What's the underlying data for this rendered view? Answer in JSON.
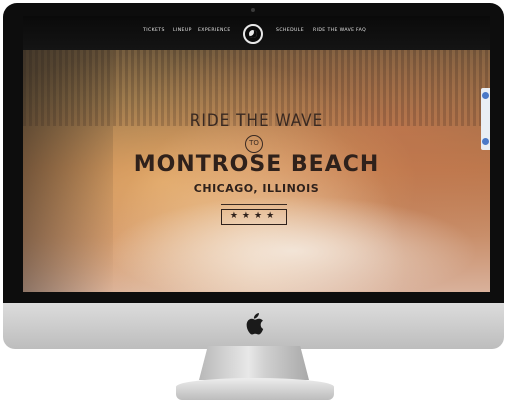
{
  "nav": {
    "left": [
      "TICKETS",
      "LINEUP",
      "EXPERIENCE"
    ],
    "right": [
      "SCHEDULE",
      "RIDE THE WAVE",
      "FAQ"
    ]
  },
  "hero": {
    "tagline": "RIDE THE WAVE",
    "connector": "TO",
    "location": "MONTROSE BEACH",
    "city": "CHICAGO, ILLINOIS",
    "stars": "★★★★"
  },
  "icons": {
    "device": "apple-logo-icon",
    "site_logo": "festival-logo-icon",
    "chat": "chat-tab-icon"
  }
}
